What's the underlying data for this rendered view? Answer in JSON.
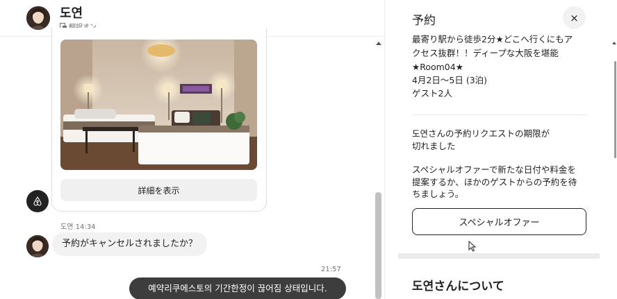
{
  "header": {
    "host_name": "도연",
    "translation_status": "翻訳オン"
  },
  "thread": {
    "listing_card": {
      "details_button": "詳細を表示"
    },
    "incoming_message": {
      "sender": "도연",
      "time": "14:34",
      "text": "予約がキャンセルされましたか？"
    },
    "outgoing_message": {
      "time": "21:57",
      "text": "예약리쿠에스토의 기간한정이 끊어짐 상태입니다."
    }
  },
  "reservation_panel": {
    "title": "予約",
    "close_label": "×",
    "listing_line1": "最寄り駅から徒歩2分★どこへ行くにもア",
    "listing_line2": "クセス抜群！！ディープな大阪を堪能",
    "listing_line3": "★Room04★",
    "dates": "4月2日～5日 (3泊)",
    "guests": "ゲスト2人",
    "expired_line1": "도연さんの予約リクエストの期限が",
    "expired_line2": "切れました",
    "offer_hint_line1": "スペシャルオファーで新たな日付や料金を",
    "offer_hint_line2": "提案するか、ほかのゲストからの予約を待",
    "offer_hint_line3": "ちましょう。",
    "special_offer_button": "スペシャルオファー",
    "about_title": "도연さんについて"
  }
}
